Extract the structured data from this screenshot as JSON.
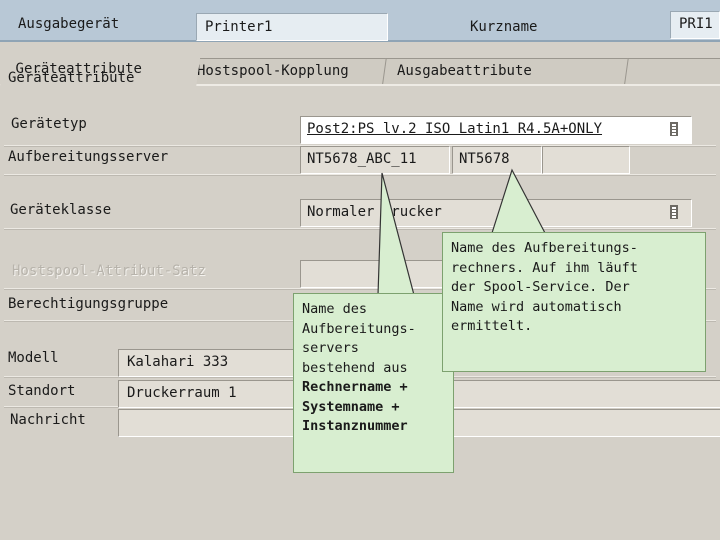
{
  "header": {
    "device_label": "Ausgabegerät",
    "device_value": "Printer1",
    "short_label": "Kurzname",
    "short_value": "PRI1"
  },
  "tabs": [
    {
      "label": "Geräteattribute",
      "active": true
    },
    {
      "label": "Hostspool-Kopplung",
      "active": false
    },
    {
      "label": "Ausgabeattribute",
      "active": false
    }
  ],
  "form": {
    "device_type_label": "Gerätetyp",
    "device_type_value": "Post2:PS lv.2 ISO Latin1 R4.5A+ONLY",
    "formatting_server_label": "Aufbereitungsserver",
    "formatting_server_value": "NT5678_ABC_11",
    "formatting_host_value": "NT5678",
    "device_class_label": "Geräteklasse",
    "device_class_value": "Normaler Drucker",
    "hostspool_attr_label": "Hostspool-Attribut-Satz",
    "auth_group_label": "Berechtigungsgruppe",
    "model_label": "Modell",
    "model_value": "Kalahari 333",
    "location_label": "Standort",
    "location_value": "Druckerraum 1",
    "message_label": "Nachricht"
  },
  "callouts": {
    "server_note_text": "Name des\nAufbereitungs-\nservers\nbestehend aus",
    "server_note_bold_1": "Rechnername +",
    "server_note_bold_2": "Systemname +",
    "server_note_bold_3": "Instanznummer",
    "host_note_text": "Name des Aufbereitungs-\nrechners. Auf ihm läuft\nder Spool-Service. Der\nName wird automatisch\nermittelt."
  },
  "icons": {
    "dropdown": "dropdown-icon"
  }
}
